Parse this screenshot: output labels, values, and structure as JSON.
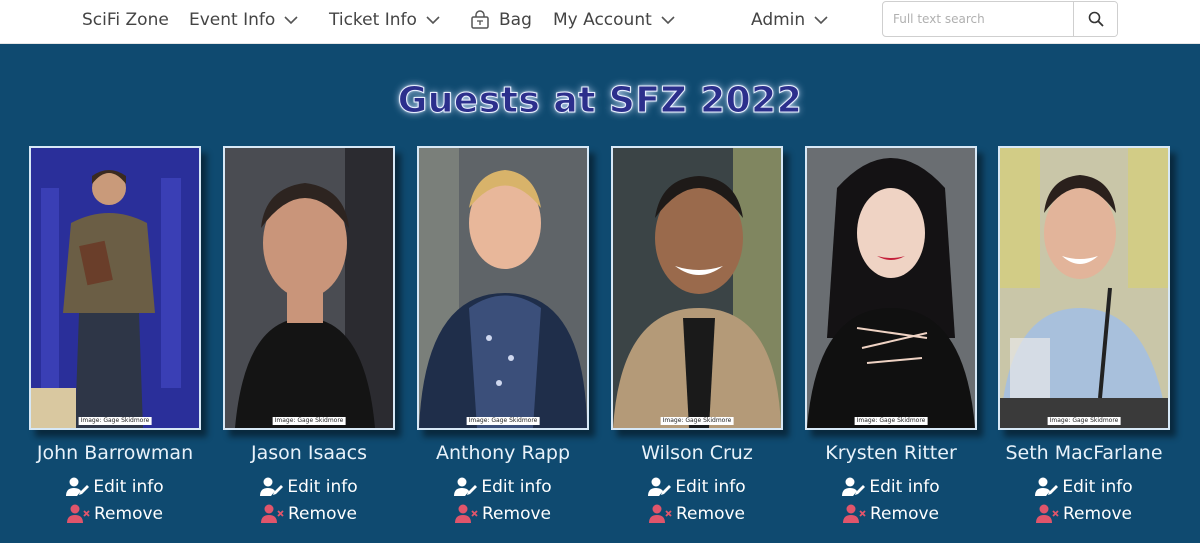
{
  "nav": {
    "brand": "SciFi Zone",
    "event_info": "Event Info",
    "ticket_info": "Ticket Info",
    "bag": "Bag",
    "my_account": "My Account",
    "admin": "Admin"
  },
  "search": {
    "placeholder": "Full text search",
    "value": ""
  },
  "page": {
    "title": "Guests at SFZ 2022"
  },
  "guests": [
    {
      "name": "John Barrowman",
      "credit": "Image: Gage Skidmore",
      "edit_label": "Edit info",
      "remove_label": "Remove"
    },
    {
      "name": "Jason Isaacs",
      "credit": "Image: Gage Skidmore",
      "edit_label": "Edit info",
      "remove_label": "Remove"
    },
    {
      "name": "Anthony Rapp",
      "credit": "Image: Gage Skidmore",
      "edit_label": "Edit info",
      "remove_label": "Remove"
    },
    {
      "name": "Wilson Cruz",
      "credit": "Image: Gage Skidmore",
      "edit_label": "Edit info",
      "remove_label": "Remove"
    },
    {
      "name": "Krysten Ritter",
      "credit": "Image: Gage Skidmore",
      "edit_label": "Edit info",
      "remove_label": "Remove"
    },
    {
      "name": "Seth MacFarlane",
      "credit": "Image: Gage Skidmore",
      "edit_label": "Edit info",
      "remove_label": "Remove"
    }
  ],
  "colors": {
    "navbar_bg": "#ffffff",
    "page_bg": "#0f4a70",
    "title_fill": "#2c2f8c",
    "remove_icon": "#e0556b",
    "edit_icon": "#ffffff"
  },
  "icons": {
    "dropdown": "chevron-down-icon",
    "bag": "bag-icon",
    "search": "search-icon",
    "edit": "user-edit-icon",
    "remove": "user-remove-icon"
  }
}
